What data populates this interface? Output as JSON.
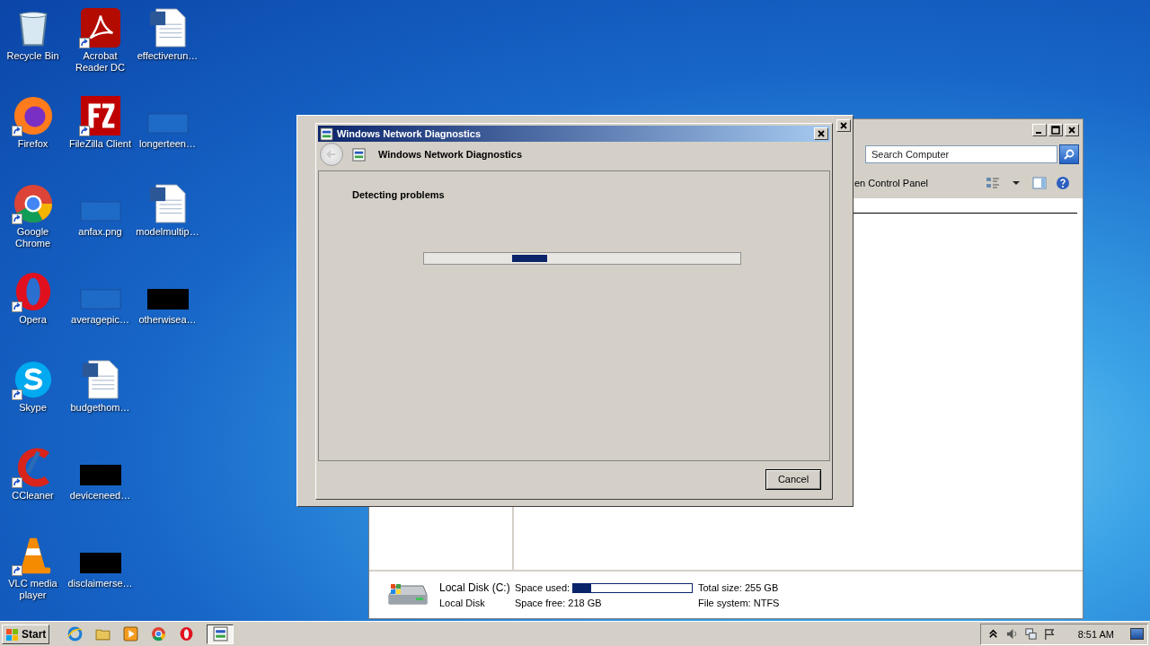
{
  "desktop_icons": [
    {
      "label": "Recycle Bin",
      "kind": "recycle",
      "shortcut": false
    },
    {
      "label": "Firefox",
      "kind": "firefox",
      "shortcut": true
    },
    {
      "label": "Google Chrome",
      "kind": "chrome",
      "shortcut": true
    },
    {
      "label": "Opera",
      "kind": "opera",
      "shortcut": true
    },
    {
      "label": "Skype",
      "kind": "skype",
      "shortcut": true
    },
    {
      "label": "CCleaner",
      "kind": "ccleaner",
      "shortcut": true
    },
    {
      "label": "VLC media player",
      "kind": "vlc",
      "shortcut": true
    },
    {
      "label": "Acrobat Reader DC",
      "kind": "acrobat",
      "shortcut": true
    },
    {
      "label": "FileZilla Client",
      "kind": "filezilla",
      "shortcut": true
    },
    {
      "label": "anfax.png",
      "kind": "blank",
      "shortcut": false
    },
    {
      "label": "averagepic…",
      "kind": "blank",
      "shortcut": false
    },
    {
      "label": "budgethom…",
      "kind": "word",
      "shortcut": false
    },
    {
      "label": "deviceneed…",
      "kind": "black",
      "shortcut": false
    },
    {
      "label": "disclaimerse…",
      "kind": "black",
      "shortcut": false
    },
    {
      "label": "effectiverun…",
      "kind": "word",
      "shortcut": false
    },
    {
      "label": "longerteen…",
      "kind": "blank",
      "shortcut": false
    },
    {
      "label": "modelmultip…",
      "kind": "word",
      "shortcut": false
    },
    {
      "label": "otherwisea…",
      "kind": "black",
      "shortcut": false
    }
  ],
  "explorer": {
    "search": {
      "placeholder": "Search Computer"
    },
    "toolbar_label": "en Control Panel",
    "details": {
      "name": "Local Disk (C:)",
      "type": "Local Disk",
      "space_used_label": "Space used:",
      "level": 0.15,
      "space_free": "Space free: 218 GB",
      "total_size": "Total size: 255 GB",
      "file_system": "File system: NTFS"
    }
  },
  "dialog": {
    "title": "Windows Network Diagnostics",
    "header": "Windows Network Diagnostics",
    "status": "Detecting problems",
    "progress": {
      "on": true
    },
    "button": "Cancel"
  },
  "taskbar": {
    "start": "Start",
    "quick_launch": [
      {
        "kind": "ie"
      },
      {
        "kind": "folder"
      },
      {
        "kind": "media"
      },
      {
        "kind": "chrome"
      },
      {
        "kind": "opera"
      }
    ],
    "tasks": [
      {
        "kind": "network",
        "selected": true
      }
    ],
    "clock": "8:51 AM"
  }
}
